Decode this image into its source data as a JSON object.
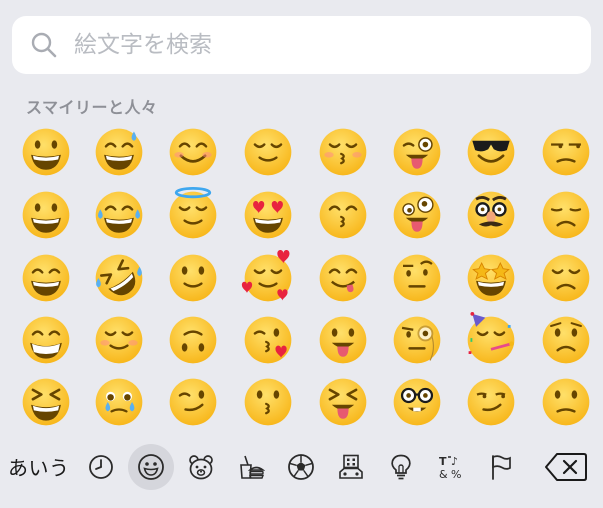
{
  "search": {
    "placeholder": "絵文字を検索",
    "icon": "search-icon"
  },
  "category_title": "スマイリーと人々",
  "emoji_grid": {
    "rows": [
      [
        "grinning-face",
        "grinning-face-with-sweat",
        "smiling-face-with-smiling-eyes",
        "relieved-face",
        "kissing-face-with-closed-eyes",
        "winking-face-with-tongue",
        "smiling-face-with-sunglasses",
        "unamused-face"
      ],
      [
        "grinning-face-with-big-eyes",
        "face-with-tears-of-joy",
        "smiling-face-with-halo",
        "smiling-face-with-heart-eyes",
        "kissing-face-with-smiling-eyes",
        "zany-face",
        "disguised-face",
        "disappointed-face"
      ],
      [
        "grinning-face-with-smiling-eyes",
        "rolling-on-the-floor-laughing",
        "slightly-smiling-face",
        "smiling-face-with-hearts",
        "face-savoring-food",
        "face-with-raised-eyebrow",
        "star-struck",
        "pensive-face"
      ],
      [
        "beaming-face-with-smiling-eyes",
        "smiling-face",
        "upside-down-face",
        "face-blowing-a-kiss",
        "face-with-tongue",
        "face-with-monocle",
        "partying-face",
        "worried-face"
      ],
      [
        "grinning-squinting-face",
        "face-holding-back-tears",
        "winking-face",
        "kissing-face",
        "squinting-face-with-tongue",
        "nerd-face",
        "smirking-face",
        "confused-face"
      ]
    ]
  },
  "bottom_bar": {
    "keyboard_switch_label": "あいう",
    "categories": [
      {
        "icon": "clock-icon",
        "active": false
      },
      {
        "icon": "smiley-icon",
        "active": true
      },
      {
        "icon": "bear-icon",
        "active": false
      },
      {
        "icon": "food-icon",
        "active": false
      },
      {
        "icon": "soccer-ball-icon",
        "active": false
      },
      {
        "icon": "building-icon",
        "active": false
      },
      {
        "icon": "lightbulb-icon",
        "active": false
      },
      {
        "icon": "symbols-icon",
        "active": false
      },
      {
        "icon": "flag-icon",
        "active": false
      }
    ],
    "backspace_icon": "backspace-icon"
  },
  "colors": {
    "background": "#e9eaef",
    "emoji_yellow": "#ffcc4d",
    "emoji_dark": "#664500",
    "icon_stroke": "#2b2b2b"
  }
}
